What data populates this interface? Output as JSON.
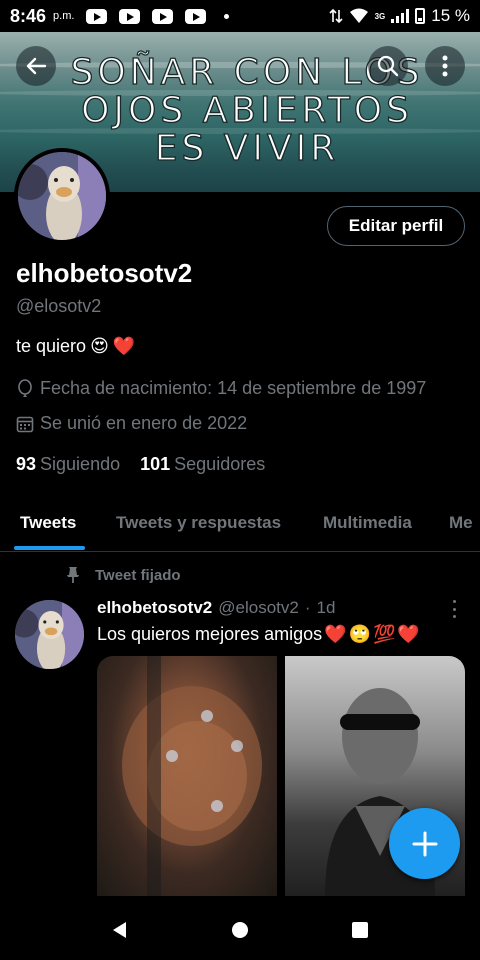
{
  "status_bar": {
    "time": "8:46",
    "ampm": "p.m.",
    "network": "3G",
    "battery": "15 %",
    "notification_icons": [
      "youtube-icon",
      "youtube-icon",
      "youtube-icon",
      "youtube-icon"
    ]
  },
  "header": {
    "banner_text_lines": [
      "SOÑAR CON LOS",
      "OJOS ABIERTOS",
      "ES VIVIR"
    ],
    "back_icon": "arrow-left-icon",
    "search_icon": "search-icon",
    "more_icon": "more-vertical-icon"
  },
  "profile": {
    "edit_label": "Editar perfil",
    "display_name": "elhobetosotv2",
    "handle": "@elosotv2",
    "bio_text": "te quiero",
    "bio_emojis": [
      "😍",
      "❤️"
    ],
    "birth_label": "Fecha de nacimiento: 14 de septiembre de 1997",
    "joined_label": "Se unió en enero de 2022",
    "following_count": "93",
    "following_label": "Siguiendo",
    "followers_count": "101",
    "followers_label": "Seguidores"
  },
  "tabs": [
    {
      "label": "Tweets",
      "active": true
    },
    {
      "label": "Tweets y respuestas",
      "active": false
    },
    {
      "label": "Multimedia",
      "active": false
    },
    {
      "label": "Me",
      "active": false
    }
  ],
  "tweet": {
    "pinned_label": "Tweet fijado",
    "author_name": "elhobetosotv2",
    "author_handle": "@elosotv2",
    "separator": "·",
    "time": "1d",
    "text": "Los quieros mejores amigos",
    "text_emojis": [
      "❤️",
      "🙄",
      "💯",
      "❤️"
    ]
  },
  "colors": {
    "accent": "#1d9bf0",
    "muted": "#71767b",
    "background": "#000000",
    "divider": "#2f3336"
  }
}
